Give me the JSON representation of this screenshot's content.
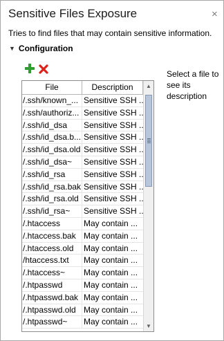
{
  "panel": {
    "title": "Sensitive Files Exposure",
    "close_glyph": "×",
    "description": "Tries to find files that may contain sensitive information.",
    "section_label": "Configuration",
    "section_toggle_glyph": "▼"
  },
  "toolbar": {
    "add_icon": "plus-icon",
    "remove_icon": "x-icon",
    "add_color": "#2e9e2e",
    "remove_color": "#d9221c"
  },
  "hint": "Select a file to see its description",
  "table": {
    "columns": [
      "File",
      "Description"
    ],
    "rows": [
      {
        "file": "/.ssh/known_...",
        "description": "Sensitive SSH ..."
      },
      {
        "file": "/.ssh/authoriz...",
        "description": "Sensitive SSH ..."
      },
      {
        "file": "/.ssh/id_dsa",
        "description": "Sensitive SSH ..."
      },
      {
        "file": "/.ssh/id_dsa.b...",
        "description": "Sensitive SSH ..."
      },
      {
        "file": "/.ssh/id_dsa.old",
        "description": "Sensitive SSH ..."
      },
      {
        "file": "/.ssh/id_dsa~",
        "description": "Sensitive SSH ..."
      },
      {
        "file": "/.ssh/id_rsa",
        "description": "Sensitive SSH ..."
      },
      {
        "file": "/.ssh/id_rsa.bak",
        "description": "Sensitive SSH ..."
      },
      {
        "file": "/.ssh/id_rsa.old",
        "description": "Sensitive SSH ..."
      },
      {
        "file": "/.ssh/id_rsa~",
        "description": "Sensitive SSH ..."
      },
      {
        "file": "/.htaccess",
        "description": "May contain ..."
      },
      {
        "file": "/.htaccess.bak",
        "description": "May contain ..."
      },
      {
        "file": "/.htaccess.old",
        "description": "May contain ..."
      },
      {
        "file": "/htaccess.txt",
        "description": "May contain ..."
      },
      {
        "file": "/.htaccess~",
        "description": "May contain ..."
      },
      {
        "file": "/.htpasswd",
        "description": "May contain ..."
      },
      {
        "file": "/.htpasswd.bak",
        "description": "May contain ..."
      },
      {
        "file": "/.htpasswd.old",
        "description": "May contain ..."
      },
      {
        "file": "/.htpasswd~",
        "description": "May contain ..."
      }
    ]
  },
  "scrollbar": {
    "up_glyph": "▲",
    "down_glyph": "▼"
  }
}
